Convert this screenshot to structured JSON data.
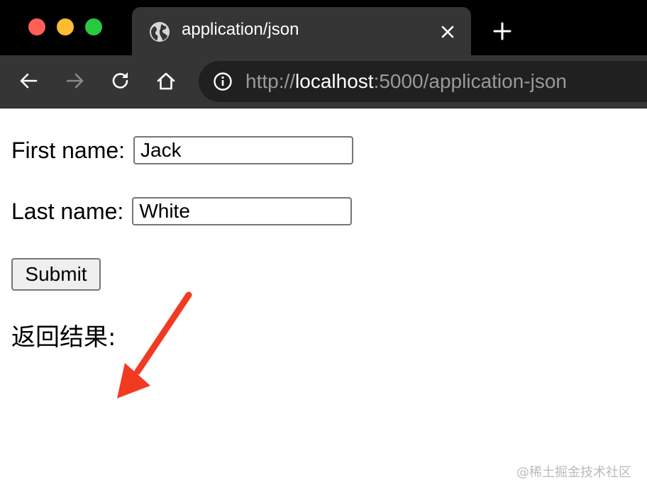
{
  "browser": {
    "tab": {
      "title": "application/json",
      "icon": "globe-icon"
    },
    "traffic_lights": {
      "close": "#fe5f57",
      "minimize": "#febc2e",
      "zoom": "#28c840"
    },
    "url": {
      "scheme": "http://",
      "host": "localhost",
      "rest": ":5000/application-json"
    }
  },
  "form": {
    "first_name_label": "First name:",
    "first_name_value": "Jack",
    "last_name_label": "Last name:",
    "last_name_value": "White",
    "submit_label": "Submit"
  },
  "result_label": "返回结果:",
  "annotation": {
    "arrow_color": "#f23a22"
  },
  "watermark": "@稀土掘金技术社区"
}
